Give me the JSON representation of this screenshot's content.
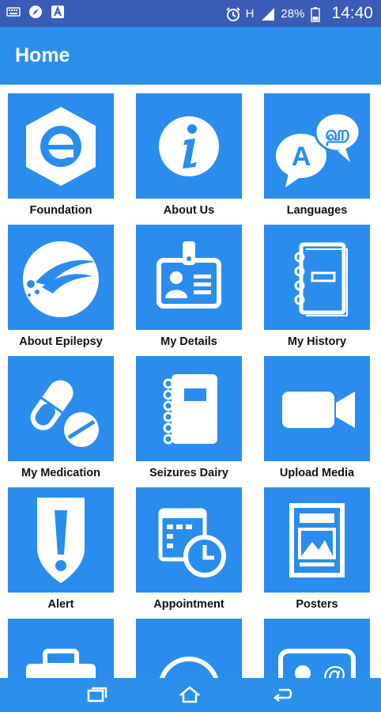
{
  "status_bar": {
    "battery": "28%",
    "time": "14:40",
    "network": "H"
  },
  "app_bar": {
    "title": "Home"
  },
  "tiles": [
    {
      "label": "Foundation",
      "icon": "foundation-logo-icon"
    },
    {
      "label": "About Us",
      "icon": "info-icon"
    },
    {
      "label": "Languages",
      "icon": "languages-icon"
    },
    {
      "label": "About Epilepsy",
      "icon": "epilepsy-logo-icon"
    },
    {
      "label": "My Details",
      "icon": "id-badge-icon"
    },
    {
      "label": "My History",
      "icon": "notebook-icon"
    },
    {
      "label": "My Medication",
      "icon": "pills-icon"
    },
    {
      "label": "Seizures Dairy",
      "icon": "diary-icon"
    },
    {
      "label": "Upload Media",
      "icon": "video-camera-icon"
    },
    {
      "label": "Alert",
      "icon": "alert-shield-icon"
    },
    {
      "label": "Appointment",
      "icon": "calendar-clock-icon"
    },
    {
      "label": "Posters",
      "icon": "poster-icon"
    },
    {
      "label": "",
      "icon": "first-aid-kit-icon"
    },
    {
      "label": "",
      "icon": "chat-icon"
    },
    {
      "label": "",
      "icon": "contact-card-icon"
    }
  ],
  "colors": {
    "status_bar": "#3a5bb6",
    "app_bar": "#2b90ec",
    "tile": "#2a8ded",
    "icon": "#ffffff"
  }
}
